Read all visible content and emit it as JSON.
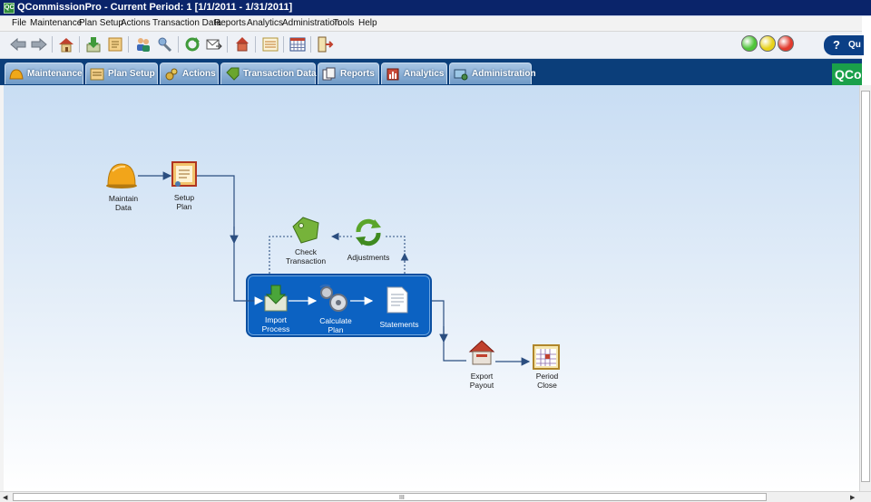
{
  "window": {
    "title": "QCommissionPro - Current Period: 1 [1/1/2011 - 1/31/2011]",
    "app_icon": "QC"
  },
  "menu": [
    "File",
    "Maintenance",
    "Plan Setup",
    "Actions",
    "Transaction Data",
    "Reports",
    "Analytics",
    "Administration",
    "Tools",
    "Help"
  ],
  "toolbar": {
    "buttons": [
      "back-icon",
      "forward-icon",
      "home-icon",
      "import-icon",
      "plan-icon",
      "users-icon",
      "connect-icon",
      "refresh-icon",
      "email-icon",
      "export-icon",
      "list-icon",
      "calendar-grid-icon",
      "exit-icon"
    ],
    "status_lights": [
      "#4fc53a",
      "#e8d21c",
      "#e23a2e"
    ],
    "quick_help": {
      "mark": "?",
      "label": "Qu"
    }
  },
  "tabs": [
    {
      "label": "Maintenance",
      "icon": "helmet-icon",
      "color": "#f0a81a"
    },
    {
      "label": "Plan Setup",
      "icon": "plan-icon",
      "color": "#e9c36a"
    },
    {
      "label": "Actions",
      "icon": "gears-icon",
      "color": "#d9b040"
    },
    {
      "label": "Transaction Data",
      "icon": "tag-icon",
      "color": "#6aa62e"
    },
    {
      "label": "Reports",
      "icon": "reports-icon",
      "color": "#ffffff"
    },
    {
      "label": "Analytics",
      "icon": "analytics-icon",
      "color": "#c84a3a"
    },
    {
      "label": "Administration",
      "icon": "admin-icon",
      "color": "#4a8a4a"
    }
  ],
  "brand": "QCo",
  "flow": {
    "nodes": {
      "maintain_data": "Maintain\nData",
      "setup_plan": "Setup\nPlan",
      "check_transaction": "Check\nTransaction",
      "adjustments": "Adjustments",
      "import_process": "Import\nProcess",
      "calculate_plan": "Calculate\nPlan",
      "statements": "Statements",
      "export_payout": "Export\nPayout",
      "period_close": "Period\nClose"
    }
  },
  "scroll": {
    "grip": "III"
  }
}
